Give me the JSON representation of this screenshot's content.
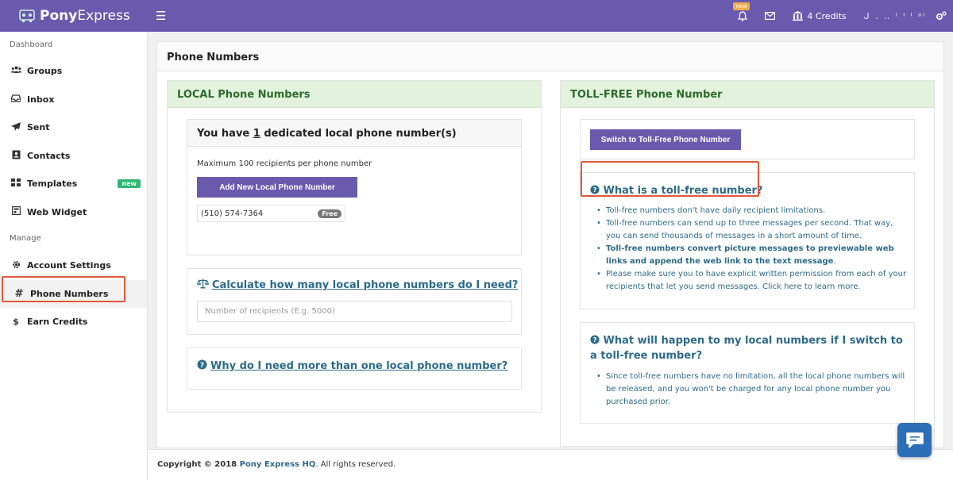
{
  "brand": {
    "bold": "Pony",
    "light": "Express"
  },
  "topbar": {
    "notification_badge": "new",
    "credits": "4 Credits",
    "user": "ᒍ . ‥ ˡ ˡ ˡ ᵃˡ"
  },
  "sidebar": {
    "dashboard_label": "Dashboard",
    "manage_label": "Manage",
    "items": [
      {
        "label": "Groups",
        "icon": "users-icon"
      },
      {
        "label": "Inbox",
        "icon": "inbox-icon"
      },
      {
        "label": "Sent",
        "icon": "paper-plane-icon"
      },
      {
        "label": "Contacts",
        "icon": "address-book-icon"
      },
      {
        "label": "Templates",
        "icon": "grid-icon",
        "badge": "new"
      },
      {
        "label": "Web Widget",
        "icon": "widget-icon"
      },
      {
        "label": "Account Settings",
        "icon": "gear-icon"
      },
      {
        "label": "Phone Numbers",
        "icon": "hash-icon"
      },
      {
        "label": "Earn Credits",
        "icon": "dollar-icon"
      }
    ]
  },
  "page": {
    "title": "Phone Numbers"
  },
  "local": {
    "header": "LOCAL Phone Numbers",
    "card_title_pre": "You have ",
    "card_title_count": "1",
    "card_title_post": " dedicated local phone number(s)",
    "max_text": "Maximum 100 recipients per phone number",
    "add_button": "Add New Local Phone Number",
    "number": "(510) 574-7364",
    "number_badge": "Free",
    "calc_link": "Calculate how many local phone numbers do I need?",
    "calc_placeholder": "Number of recipients (E.g. 5000)",
    "why_link": "Why do I need more than one local phone number?"
  },
  "tollfree": {
    "header": "TOLL-FREE Phone Number",
    "switch_button": "Switch to Toll-Free Phone Number",
    "q1": "What is a toll-free number?",
    "q1_items": [
      "Toll-free numbers don't have daily recipient limitations.",
      "Toll-free numbers can send up to three messages per second. That way, you can send thousands of messages in a short amount of time."
    ],
    "q1_bold_item": "Toll-free numbers convert picture messages to previewable web links and append the web link to the text message",
    "q1_bold_suffix": ".",
    "q1_last_pre": "Please make sure you to have explicit written permission from each of your recipients that let you send messages. Click ",
    "q1_last_link": "here",
    "q1_last_post": " to learn more.",
    "q2": "What will happen to my local numbers if I switch to a toll-free number?",
    "q2_items": [
      "Since toll-free numbers have no limitation, all the local phone numbers will be released, and you won't be charged for any local phone number you purchased prior."
    ]
  },
  "footer": {
    "copyright": "Copyright © 2018 ",
    "company": "Pony Express HQ",
    "rights": ". All rights reserved."
  },
  "colors": {
    "brand": "#6a5aad",
    "accent_outline": "#e0583a",
    "header_green": "#e2f2dc",
    "link_blue": "#2d6b8a"
  }
}
